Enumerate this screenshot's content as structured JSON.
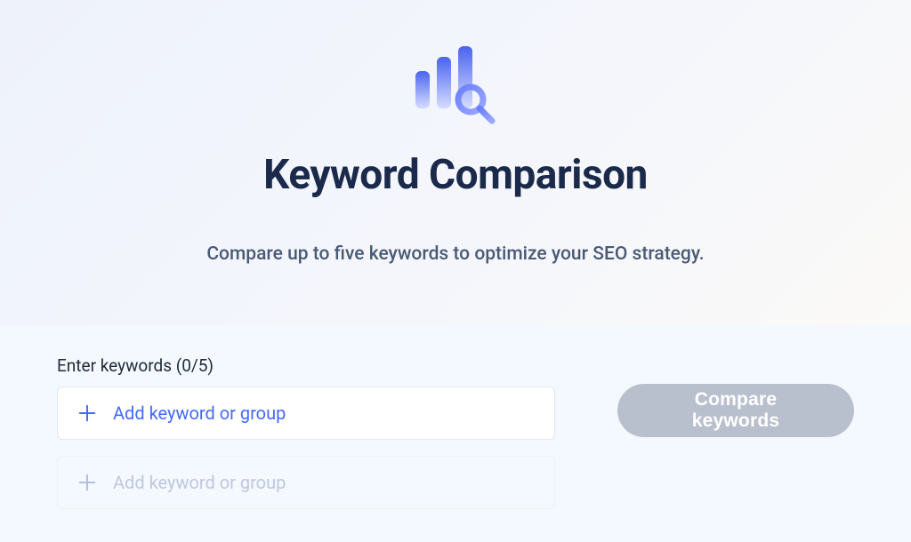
{
  "hero": {
    "title": "Keyword Comparison",
    "subtitle": "Compare up to five keywords to optimize your SEO strategy."
  },
  "form": {
    "label_prefix": "Enter keywords",
    "count_current": 0,
    "count_max": 5,
    "label": "Enter keywords (0/5)"
  },
  "inputs": [
    {
      "placeholder": "Add keyword or group",
      "active": true
    },
    {
      "placeholder": "Add keyword or group",
      "active": false
    }
  ],
  "actions": {
    "compare_label": "Compare keywords",
    "compare_enabled": false
  },
  "icons": {
    "hero": "bar-chart-search-icon",
    "plus": "plus-icon"
  },
  "colors": {
    "accent": "#4668ff",
    "title": "#1b2a4a"
  }
}
